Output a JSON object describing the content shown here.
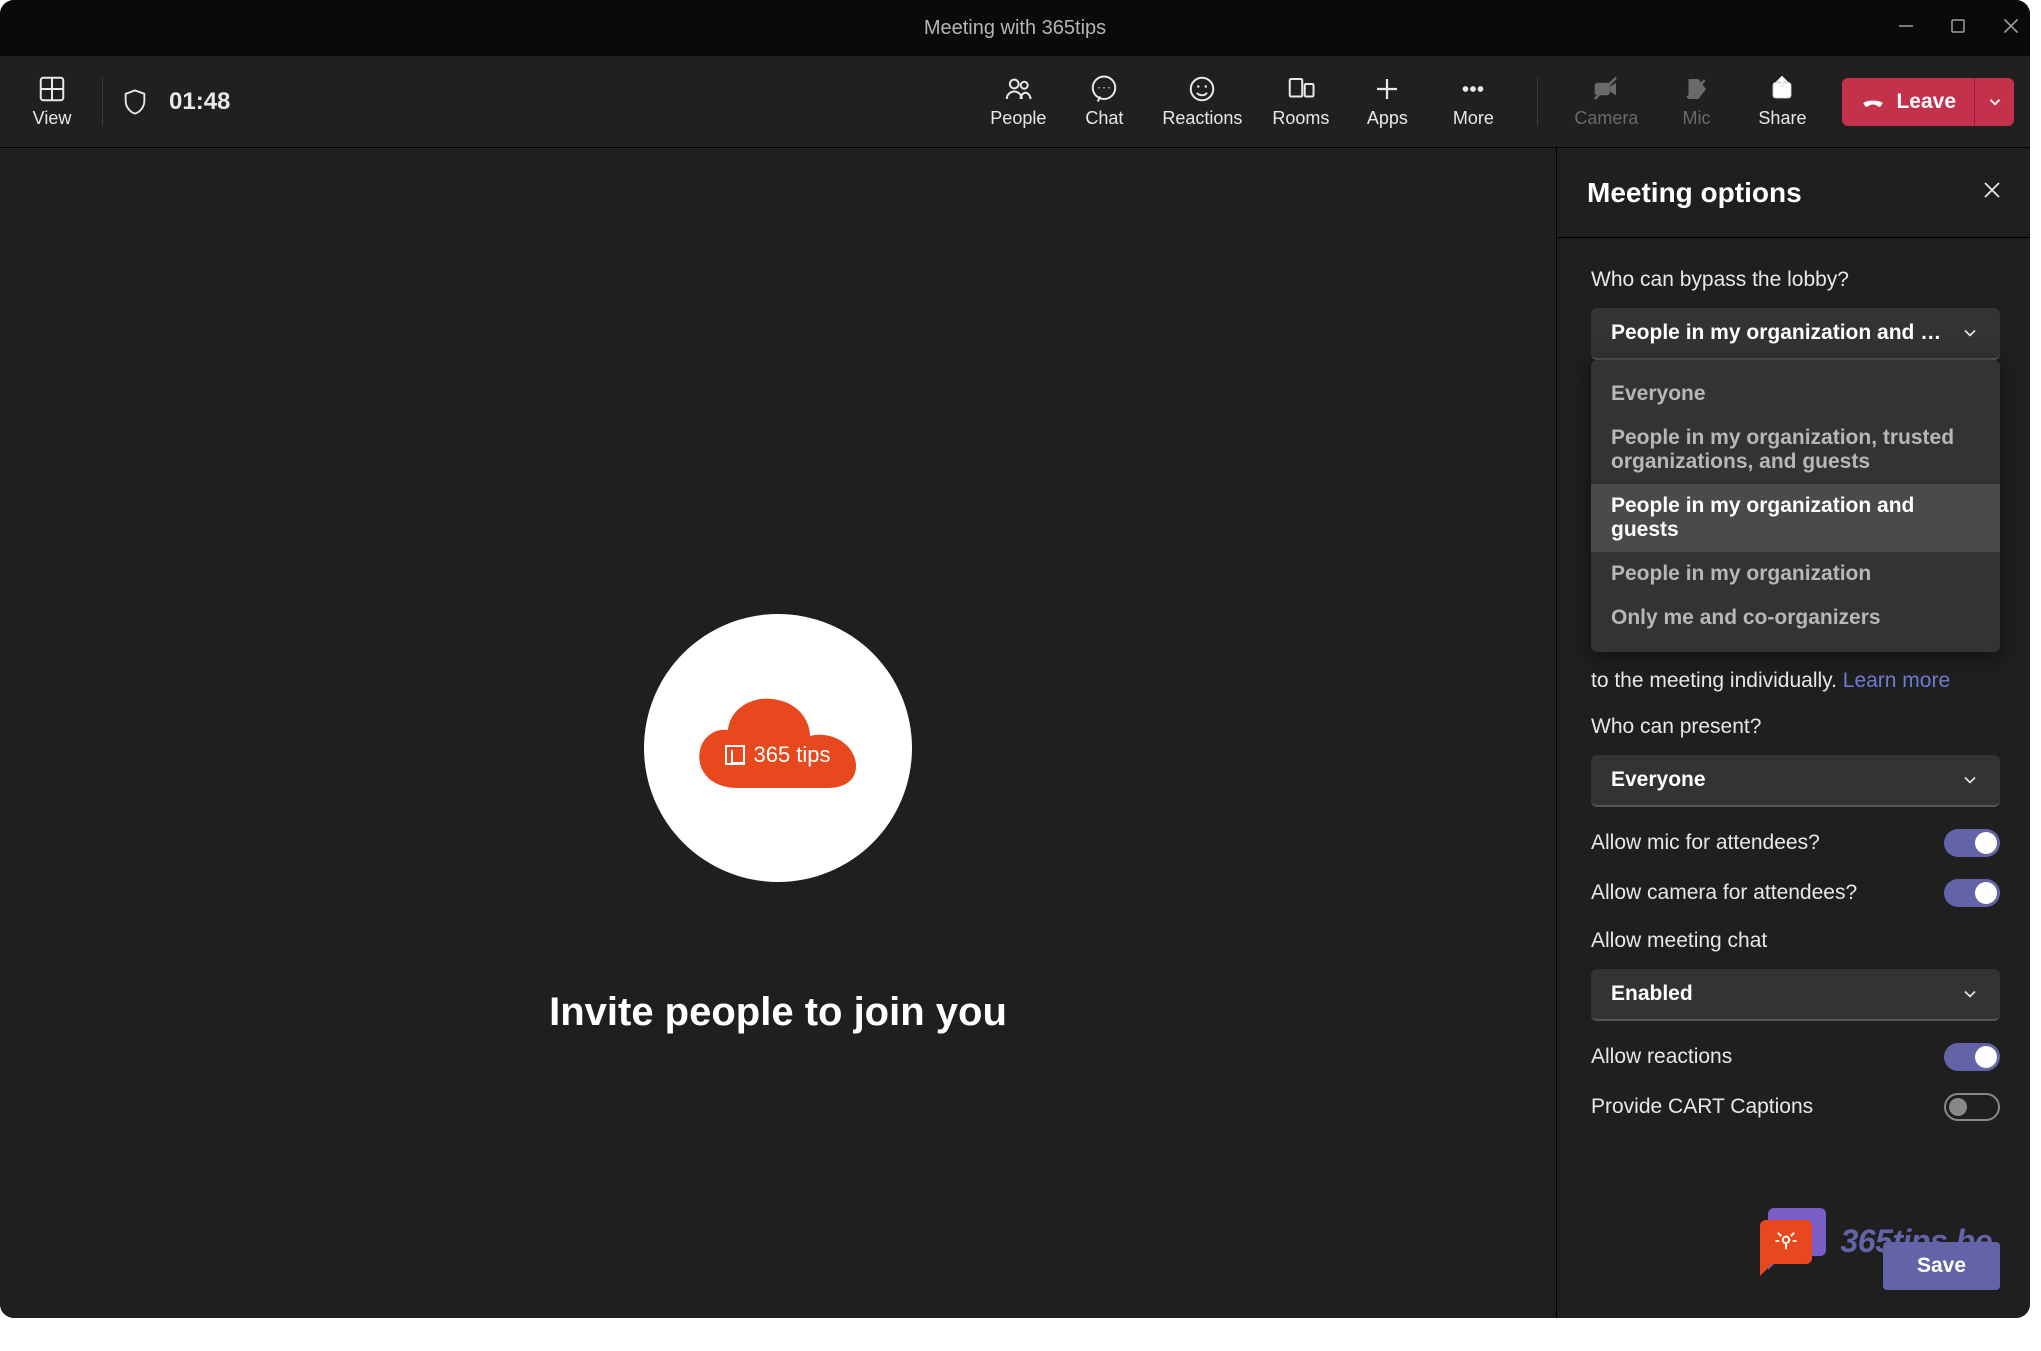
{
  "window": {
    "title": "Meeting with 365tips"
  },
  "toolbar": {
    "view": "View",
    "clock": "01:48",
    "people": "People",
    "chat": "Chat",
    "reactions": "Reactions",
    "rooms": "Rooms",
    "apps": "Apps",
    "more": "More",
    "camera": "Camera",
    "mic": "Mic",
    "share": "Share",
    "leave": "Leave"
  },
  "main": {
    "avatar_logo_text": "365 tips",
    "invite": "Invite people to join you"
  },
  "panel": {
    "title": "Meeting options",
    "lobby_label": "Who can bypass the lobby?",
    "lobby_selected": "People in my organization and …",
    "lobby_options": [
      "Everyone",
      "People in my organization, trusted organizations, and guests",
      "People in my organization and guests",
      "People in my organization",
      "Only me and co-organizers"
    ],
    "lobby_selected_index": 2,
    "helper_suffix": "to the meeting individually.",
    "learn_more": "Learn more",
    "present_label": "Who can present?",
    "present_selected": "Everyone",
    "allow_mic": "Allow mic for attendees?",
    "allow_camera": "Allow camera for attendees?",
    "allow_chat_label": "Allow meeting chat",
    "allow_chat_value": "Enabled",
    "allow_reactions": "Allow reactions",
    "provide_cart": "Provide CART Captions",
    "save": "Save"
  },
  "watermark": {
    "text": "365tips.be"
  }
}
